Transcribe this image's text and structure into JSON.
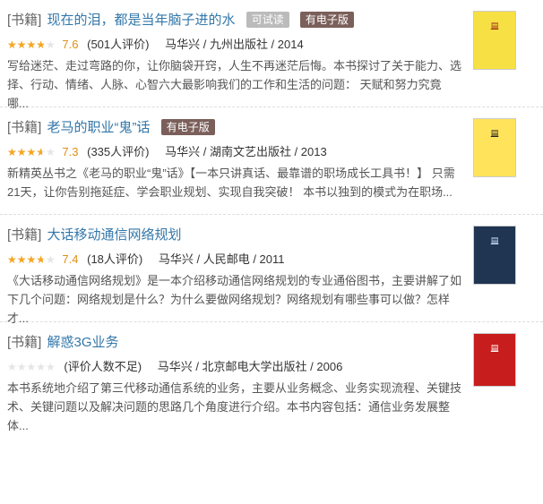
{
  "colors": {
    "link": "#3377aa",
    "star": "#f5a623",
    "rating": "#e09015",
    "ebook_badge": "#7b5f5a",
    "try_badge": "#bbbbbb"
  },
  "items": [
    {
      "tag": "[书籍]",
      "title": "现在的泪，都是当年脑子进的水",
      "badges": [
        "可试读",
        "有电子版"
      ],
      "stars": "★★★★★",
      "rating_value": 0.76,
      "rating": "7.6",
      "votes": "(501人评价)",
      "pub": "马华兴 / 九州出版社 / 2014",
      "desc": "写给迷茫、走过弯路的你，让你脑袋开窍，人生不再迷茫后悔。本书探讨了关于能力、选择、行动、情绪、人脉、心智六大最影响我们的工作和生活的问题： 天赋和努力究竟哪...",
      "cover_icon": "book-cover"
    },
    {
      "tag": "[书籍]",
      "title": "老马的职业“鬼”话",
      "badges": [
        "有电子版"
      ],
      "stars": "★★★★★",
      "rating_value": 0.73,
      "rating": "7.3",
      "votes": "(335人评价)",
      "pub": "马华兴 / 湖南文艺出版社 / 2013",
      "desc": "新精英丛书之《老马的职业“鬼”话》【一本只讲真话、最靠谱的职场成长工具书！】 只需21天，让你告别拖延症、学会职业规划、实现自我突破！ 本书以独到的模式为在职场...",
      "cover_icon": "book-cover"
    },
    {
      "tag": "[书籍]",
      "title": "大话移动通信网络规划",
      "badges": [],
      "stars": "★★★★★",
      "rating_value": 0.74,
      "rating": "7.4",
      "votes": "(18人评价)",
      "pub": "马华兴 / 人民邮电 / 2011",
      "desc": "《大话移动通信网络规划》是一本介绍移动通信网络规划的专业通俗图书，主要讲解了如下几个问题：网络规划是什么？为什么要做网络规划？网络规划有哪些事可以做？怎样才...",
      "cover_icon": "book-cover"
    },
    {
      "tag": "[书籍]",
      "title": "解惑3G业务",
      "badges": [],
      "stars": "★★★★★",
      "rating_value": 0,
      "rating": "",
      "votes": "(评价人数不足)",
      "pub": "马华兴 / 北京邮电大学出版社 / 2006",
      "desc": "本书系统地介绍了第三代移动通信系统的业务，主要从业务概念、业务实现流程、关键技术、关键问题以及解决问题的思路几个角度进行介绍。本书内容包括：通信业务发展整体...",
      "cover_icon": "book-cover"
    }
  ]
}
